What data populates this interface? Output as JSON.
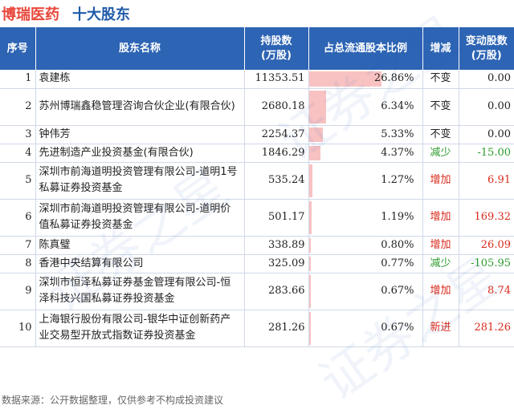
{
  "header": {
    "company": "博瑞医药",
    "subtitle": "十大股东"
  },
  "columns": {
    "rank": "序号",
    "name": "股东名称",
    "shares_line1": "持股数",
    "shares_line2": "(万股)",
    "ratio": "占总流通股本比例",
    "change_type": "增减",
    "change_line1": "变动股数",
    "change_line2": "(万股)"
  },
  "watermark": "证券之星",
  "colors": {
    "header_bg": "#2d64b4",
    "bar": "#f8c2c2",
    "increase": "#d92a1c",
    "decrease": "#2b9a2b",
    "company_title": "#e8473b",
    "subtitle": "#1f5ba8"
  },
  "chart_data": {
    "type": "table",
    "rows": [
      {
        "rank": "1",
        "name": "袁建栋",
        "shares": "11353.51",
        "ratio": "26.86%",
        "ratio_value": 26.86,
        "change_type": "不变",
        "change_class": "unchanged",
        "change": "0.00"
      },
      {
        "rank": "2",
        "name": "苏州博瑞鑫稳管理咨询合伙企业(有限合伙)",
        "shares": "2680.18",
        "ratio": "6.34%",
        "ratio_value": 6.34,
        "change_type": "不变",
        "change_class": "unchanged",
        "change": "0.00"
      },
      {
        "rank": "3",
        "name": "钟伟芳",
        "shares": "2254.37",
        "ratio": "5.33%",
        "ratio_value": 5.33,
        "change_type": "不变",
        "change_class": "unchanged",
        "change": "0.00"
      },
      {
        "rank": "4",
        "name": "先进制造产业投资基金(有限合伙)",
        "shares": "1846.29",
        "ratio": "4.37%",
        "ratio_value": 4.37,
        "change_type": "减少",
        "change_class": "decrease",
        "change": "-15.00"
      },
      {
        "rank": "5",
        "name": "深圳市前海道明投资管理有限公司-道明1号私募证券投资基金",
        "shares": "535.24",
        "ratio": "1.27%",
        "ratio_value": 1.27,
        "change_type": "增加",
        "change_class": "increase",
        "change": "6.91"
      },
      {
        "rank": "6",
        "name": "深圳市前海道明投资管理有限公司-道明价值私募证券投资基金",
        "shares": "501.17",
        "ratio": "1.19%",
        "ratio_value": 1.19,
        "change_type": "增加",
        "change_class": "increase",
        "change": "169.32"
      },
      {
        "rank": "7",
        "name": "陈真璧",
        "shares": "338.89",
        "ratio": "0.80%",
        "ratio_value": 0.8,
        "change_type": "增加",
        "change_class": "increase",
        "change": "26.09"
      },
      {
        "rank": "8",
        "name": "香港中央结算有限公司",
        "shares": "325.09",
        "ratio": "0.77%",
        "ratio_value": 0.77,
        "change_type": "减少",
        "change_class": "decrease",
        "change": "-105.95"
      },
      {
        "rank": "9",
        "name": "深圳市恒泽私募证券基金管理有限公司-恒泽科技兴国私募证券投资基金",
        "shares": "283.66",
        "ratio": "0.67%",
        "ratio_value": 0.67,
        "change_type": "增加",
        "change_class": "increase",
        "change": "8.74"
      },
      {
        "rank": "10",
        "name": "上海银行股份有限公司-银华中证创新药产业交易型开放式指数证券投资基金",
        "shares": "281.26",
        "ratio": "0.67%",
        "ratio_value": 0.67,
        "change_type": "新进",
        "change_class": "new",
        "change": "281.26"
      }
    ]
  },
  "footer": {
    "source": "数据来源：公开数据整理，仅供参考不构成投资建议"
  }
}
